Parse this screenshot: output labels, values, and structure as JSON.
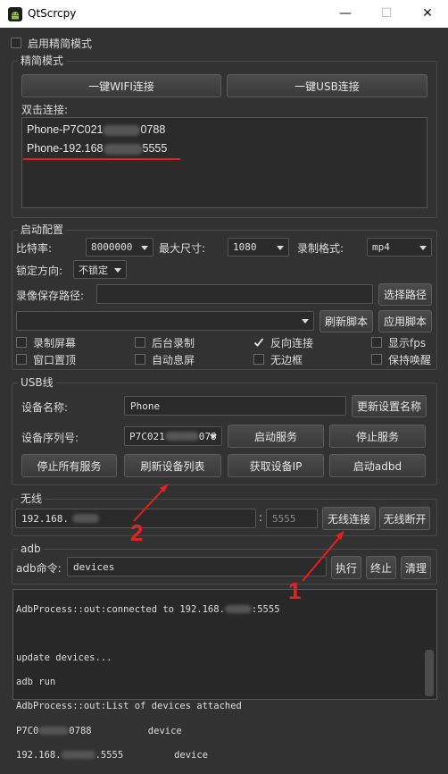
{
  "window": {
    "title": "QtScrcpy",
    "minimize": "—",
    "maximize": "☐",
    "close": "✕"
  },
  "simple_mode": {
    "checkbox_label": "启用精简模式",
    "group_title": "精简模式",
    "wifi_button": "一键WIFI连接",
    "usb_button": "一键USB连接",
    "dblclick_label": "双击连接:",
    "devices": [
      {
        "prefix": "Phone-P7C021",
        "suffix": "0788"
      },
      {
        "prefix": "Phone-192.168",
        "suffix": "5555"
      }
    ]
  },
  "config": {
    "group_title": "启动配置",
    "bitrate_label": "比特率:",
    "bitrate_value": "8000000",
    "max_size_label": "最大尺寸:",
    "max_size_value": "1080",
    "record_format_label": "录制格式:",
    "record_format_value": "mp4",
    "lock_dir_label": "锁定方向:",
    "lock_dir_value": "不锁定",
    "record_path_label": "录像保存路径:",
    "record_path_value": "",
    "select_path_button": "选择路径",
    "script_value": "",
    "refresh_script_button": "刷新脚本",
    "apply_script_button": "应用脚本",
    "checkboxes": [
      {
        "label": "录制屏幕",
        "checked": false
      },
      {
        "label": "后台录制",
        "checked": false
      },
      {
        "label": "反向连接",
        "checked": true
      },
      {
        "label": "显示fps",
        "checked": false
      },
      {
        "label": "窗口置顶",
        "checked": false
      },
      {
        "label": "自动息屏",
        "checked": false
      },
      {
        "label": "无边框",
        "checked": false
      },
      {
        "label": "保持唤醒",
        "checked": false
      }
    ]
  },
  "usb": {
    "group_title": "USB线",
    "device_name_label": "设备名称:",
    "device_name_value": "Phone",
    "update_name_button": "更新设置名称",
    "serial_label": "设备序列号:",
    "serial_value_prefix": "P7C021",
    "serial_value_suffix": "078",
    "start_service_button": "启动服务",
    "stop_service_button": "停止服务",
    "stop_all_button": "停止所有服务",
    "refresh_devices_button": "刷新设备列表",
    "get_ip_button": "获取设备IP",
    "start_adbd_button": "启动adbd"
  },
  "wireless": {
    "group_title": "无线",
    "ip_value": "192.168.",
    "separator": ":",
    "port_placeholder": "5555",
    "connect_button": "无线连接",
    "disconnect_button": "无线断开"
  },
  "adb": {
    "group_title": "adb",
    "cmd_label": "adb命令:",
    "cmd_value": "devices",
    "exec_button": "执行",
    "stop_button": "终止",
    "clear_button": "清理"
  },
  "log": {
    "line1_a": "AdbProcess::out:connected to 192.168.",
    "line1_b": ":5555",
    "line2": "update devices...",
    "line3": "adb run",
    "line4": "AdbProcess::out:List of devices attached",
    "line5_a": "P7C0",
    "line5_b": "0788          device",
    "line6_a": "192.168.",
    "line6_b": ".5555         device"
  },
  "annotations": {
    "one": "1",
    "two": "2"
  },
  "colors": {
    "background": "#323232",
    "annotation_red": "#e51f1f"
  }
}
